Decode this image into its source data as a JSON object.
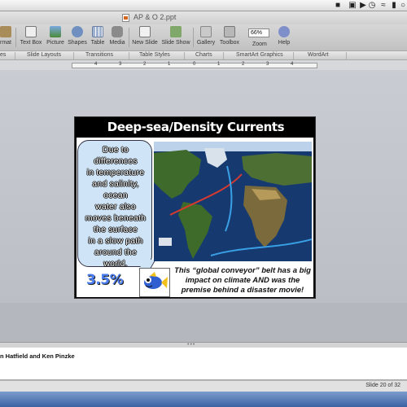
{
  "menubar": {
    "icons": [
      "dropbox-icon",
      "display-icon",
      "volume-icon",
      "time-machine-icon",
      "wifi-icon",
      "battery-icon",
      "clock-icon"
    ]
  },
  "window": {
    "title": "AP & O 2.ppt"
  },
  "toolbar": {
    "items": [
      {
        "label": "rmat",
        "icon": "format-icon"
      },
      {
        "label": "Text Box",
        "icon": "text-box-icon"
      },
      {
        "label": "Picture",
        "icon": "picture-icon"
      },
      {
        "label": "Shapes",
        "icon": "shapes-icon"
      },
      {
        "label": "Table",
        "icon": "table-icon"
      },
      {
        "label": "Media",
        "icon": "media-icon"
      },
      {
        "label": "New Slide",
        "icon": "new-slide-icon"
      },
      {
        "label": "Slide Show",
        "icon": "slide-show-icon"
      },
      {
        "label": "Gallery",
        "icon": "gallery-icon"
      },
      {
        "label": "Toolbox",
        "icon": "toolbox-icon"
      },
      {
        "label": "Zoom",
        "icon": "zoom-icon"
      },
      {
        "label": "Help",
        "icon": "help-icon"
      }
    ],
    "zoom_value": "66%"
  },
  "ribbon": {
    "tabs": [
      "es",
      "Slide Layouts",
      "Transitions",
      "Table Styles",
      "Charts",
      "SmartArt Graphics",
      "WordArt"
    ]
  },
  "ruler": {
    "labels": [
      "4",
      "3",
      "2",
      "1",
      "0",
      "1",
      "2",
      "3",
      "4"
    ]
  },
  "slide": {
    "title": "Deep-sea/Density Currents",
    "bubble_lines": [
      "Due to",
      "differences",
      "in temperature",
      "and salinity,",
      "ocean",
      "water also",
      "moves beneath",
      "the surface",
      "in a slow path",
      "around the",
      "world."
    ],
    "percent": "3.5%",
    "caption_line1": "This “global conveyor” belt has a big",
    "caption_line2": "impact on climate AND was the",
    "caption_line3": "premise behind a disaster movie!",
    "colors": {
      "title_bg": "#000000",
      "bubble_bg": "#cfe4f6",
      "percent": "#4a7df0"
    }
  },
  "notes": {
    "text": "n Hatfield and Ken Pinzke"
  },
  "status": {
    "slide_counter": "Slide 20 of 32"
  }
}
